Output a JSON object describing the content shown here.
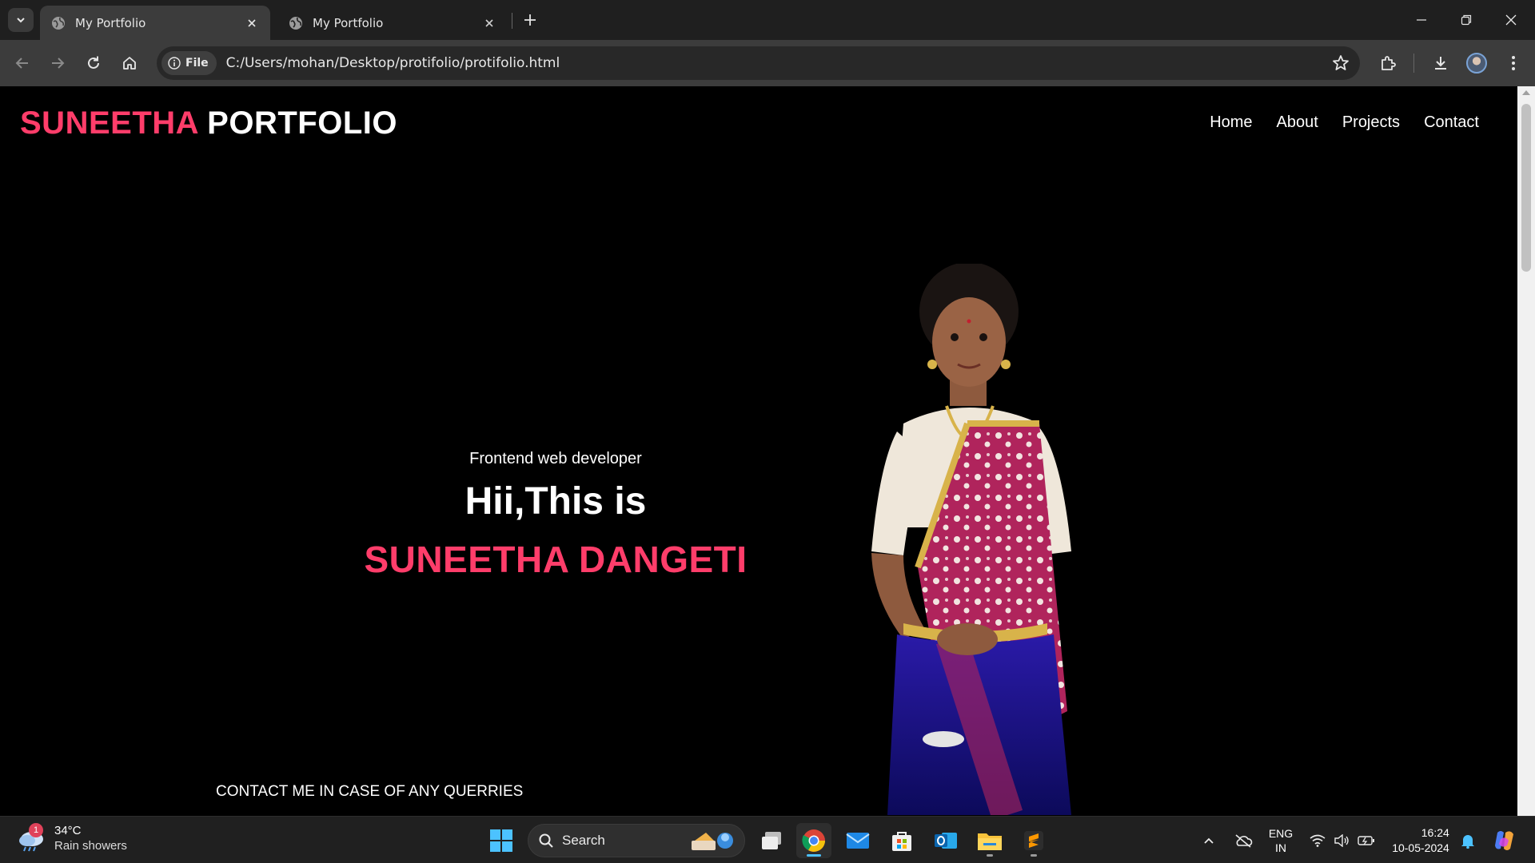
{
  "browser": {
    "tabs": [
      {
        "title": "My Portfolio",
        "active": true
      },
      {
        "title": "My Portfolio",
        "active": false
      }
    ],
    "address": {
      "chip_label": "File",
      "url": "C:/Users/mohan/Desktop/protifolio/protifolio.html"
    }
  },
  "site": {
    "logo_accent": "SUNEETHA",
    "logo_rest": "PORTFOLIO",
    "nav": [
      "Home",
      "About",
      "Projects",
      "Contact"
    ],
    "hero": {
      "role": "Frontend web developer",
      "greeting": "Hii,This is",
      "name": "SUNEETHA DANGETI"
    },
    "contact_text": "CONTACT ME IN CASE OF ANY QUERRIES",
    "colors": {
      "accent": "#ff3d6a",
      "background": "#000000",
      "text": "#ffffff"
    }
  },
  "taskbar": {
    "weather": {
      "badge": "1",
      "temp": "34°C",
      "desc": "Rain showers"
    },
    "search_label": "Search",
    "apps": [
      "task-view",
      "chrome",
      "mail",
      "microsoft-store",
      "outlook",
      "file-explorer",
      "sublime-text"
    ],
    "language": {
      "line1": "ENG",
      "line2": "IN"
    },
    "clock": {
      "time": "16:24",
      "date": "10-05-2024"
    }
  }
}
